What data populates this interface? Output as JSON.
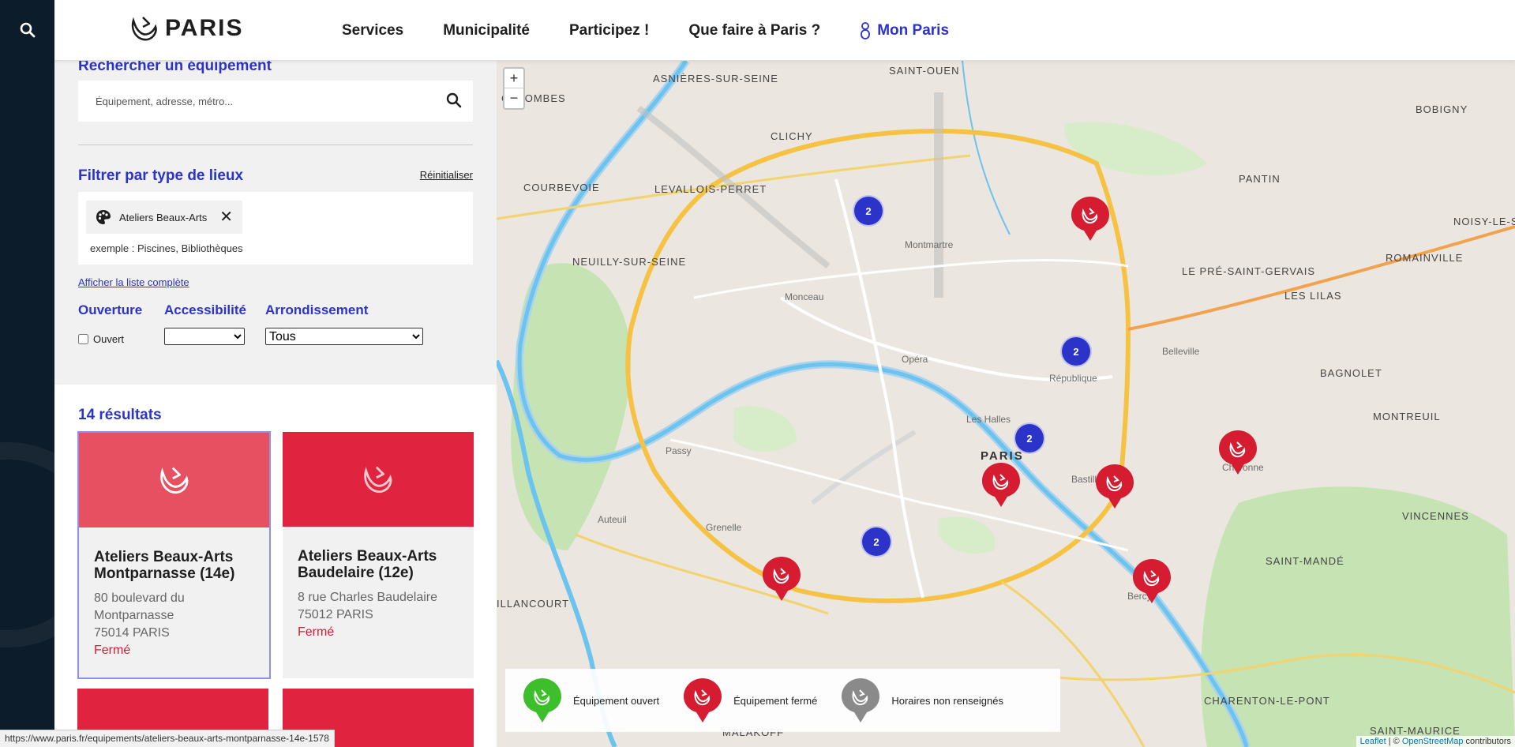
{
  "header": {
    "logo_text": "PARIS",
    "nav": [
      "Services",
      "Municipalité",
      "Participez !",
      "Que faire à Paris ?"
    ],
    "account_label": "Mon Paris"
  },
  "search": {
    "title": "Rechercher un équipement",
    "placeholder": "Équipement, adresse, métro..."
  },
  "filters": {
    "title": "Filtrer par type de lieux",
    "reset_label": "Réinitialiser",
    "selected_tag": "Ateliers Beaux-Arts",
    "example_text": "exemple : Piscines, Bibliothèques",
    "full_list_link": "Afficher la liste complète",
    "opening_label": "Ouverture",
    "open_checkbox_label": "Ouvert",
    "accessibility_label": "Accessibilité",
    "accessibility_value": "",
    "district_label": "Arrondissement",
    "district_value": "Tous"
  },
  "results": {
    "count_label": "14 résultats",
    "cards": [
      {
        "name": "Ateliers Beaux-Arts Montparnasse (14e)",
        "address_line1": "80 boulevard du",
        "address_line2": "Montparnasse",
        "address_line3": "75014 PARIS",
        "status": "Fermé"
      },
      {
        "name": "Ateliers Beaux-Arts Baudelaire (12e)",
        "address_line1": "8 rue Charles Baudelaire",
        "address_line2": "75012 PARIS",
        "status": "Fermé"
      }
    ]
  },
  "map": {
    "zoom_in": "+",
    "zoom_out": "−",
    "labels": {
      "saint_ouen": "SAINT-OUEN",
      "asnieres": "ASNIÈRES-SUR-SEINE",
      "colombes": "COLOMBES",
      "clichy": "CLICHY",
      "courbevoie": "COURBEVOIE",
      "levallois": "LEVALLOIS-PERRET",
      "neuilly": "NEUILLY-SUR-SEINE",
      "pantin": "PANTIN",
      "bobigny": "BOBIGNY",
      "noisy": "NOISY-LE-SEC",
      "romainville": "ROMAINVILLE",
      "pre_st_gervais": "LE PRÉ-SAINT-GERVAIS",
      "lilas": "LES LILAS",
      "bagnolet": "BAGNOLET",
      "montreuil": "MONTREUIL",
      "vincennes": "VINCENNES",
      "saint_mande": "SAINT-MANDÉ",
      "charenton": "CHARENTON-LE-PONT",
      "saint_maurice": "SAINT-MAURICE",
      "malakoff": "MALAKOFF",
      "billancourt": "ILLANCOURT",
      "paris": "PARIS",
      "montmartre": "Montmartre",
      "opera": "Opéra",
      "republique": "République",
      "bastille": "Bastille",
      "bercy": "Bercy",
      "grenelle": "Grenelle",
      "auteuil": "Auteuil",
      "passy": "Passy",
      "monceau": "Monceau",
      "belleville": "Belleville",
      "charonne": "Charonne",
      "les_halles": "Les Halles"
    },
    "clusters": [
      "2",
      "2",
      "2",
      "2"
    ],
    "attribution_leaflet": "Leaflet",
    "attribution_sep": " | © ",
    "attribution_osm": "OpenStreetMap",
    "attribution_suffix": " contributors"
  },
  "legend": {
    "open": "Équipement ouvert",
    "closed": "Équipement fermé",
    "unknown": "Horaires non renseignés",
    "colors": {
      "open": "#3dbe2b",
      "closed": "#d51c30",
      "unknown": "#8a8a8a",
      "brand": "#2b33c9"
    }
  },
  "statusbar": {
    "url": "https://www.paris.fr/equipements/ateliers-beaux-arts-montparnasse-14e-1578"
  }
}
